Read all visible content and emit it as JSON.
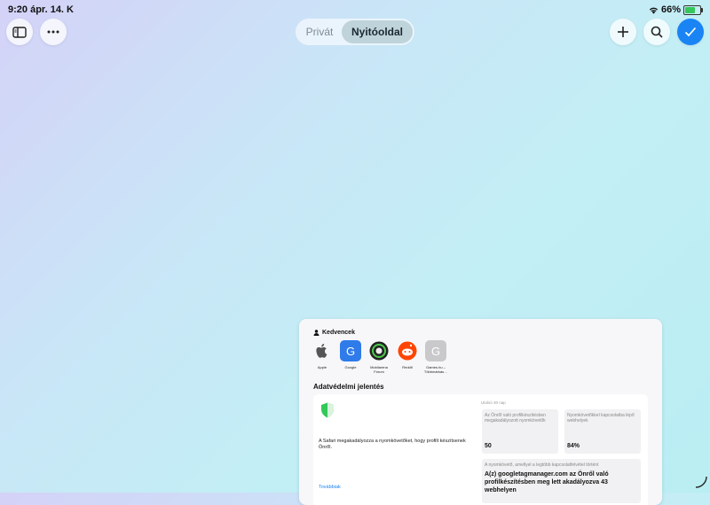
{
  "status": {
    "time_date": "9:20  ápr. 14. K",
    "battery": "66%",
    "battery_level": 0.66,
    "wifi_icon": "wifi-icon",
    "charging_icon": "charging-bolt-icon"
  },
  "toolbar": {
    "sidebar_icon": "sidebar-icon",
    "more_icon": "ellipsis-icon",
    "tabs": [
      "Privát",
      "Nyitóoldal"
    ],
    "selected_tab": "Nyitóoldal",
    "new_tab_icon": "plus-icon",
    "search_icon": "search-icon",
    "done_icon": "checkmark-icon",
    "accent": "#1a84f5"
  },
  "start_page": {
    "favorites_title": "Kedvencek",
    "favorites": [
      {
        "label": "Apple",
        "icon": "apple-icon"
      },
      {
        "label": "Google",
        "icon": "G"
      },
      {
        "label": "Mobilarena Fórum",
        "icon": "mobilarena-icon"
      },
      {
        "label": "Reddit",
        "icon": "reddit-icon"
      },
      {
        "label": "Games.hu – Többmárkás…",
        "icon": "G"
      }
    ],
    "privacy_title": "Adatvédelmi jelentés",
    "privacy_text": "A Safari megakadályozza a nyomkövetőket, hogy profilt készítsenek Önről.",
    "more_link": "Továbbiak",
    "period": "Utolsó 30 nap",
    "stat1_label": "Az Önről való profilkészítésben megakadályozott nyomkövetők",
    "stat1_value": "50",
    "stat2_label": "Nyomkövetőkkel kapcsolatba lépő webhelyek",
    "stat2_value": "84%",
    "stat3_label": "A nyomkövető, amellyel a legtöbb kapcsolatfelvétel történt",
    "stat3_value": "A(z) googletagmanager.com az Önről való profilkészítésben meg lett akadályozva 43 webhelyen"
  }
}
